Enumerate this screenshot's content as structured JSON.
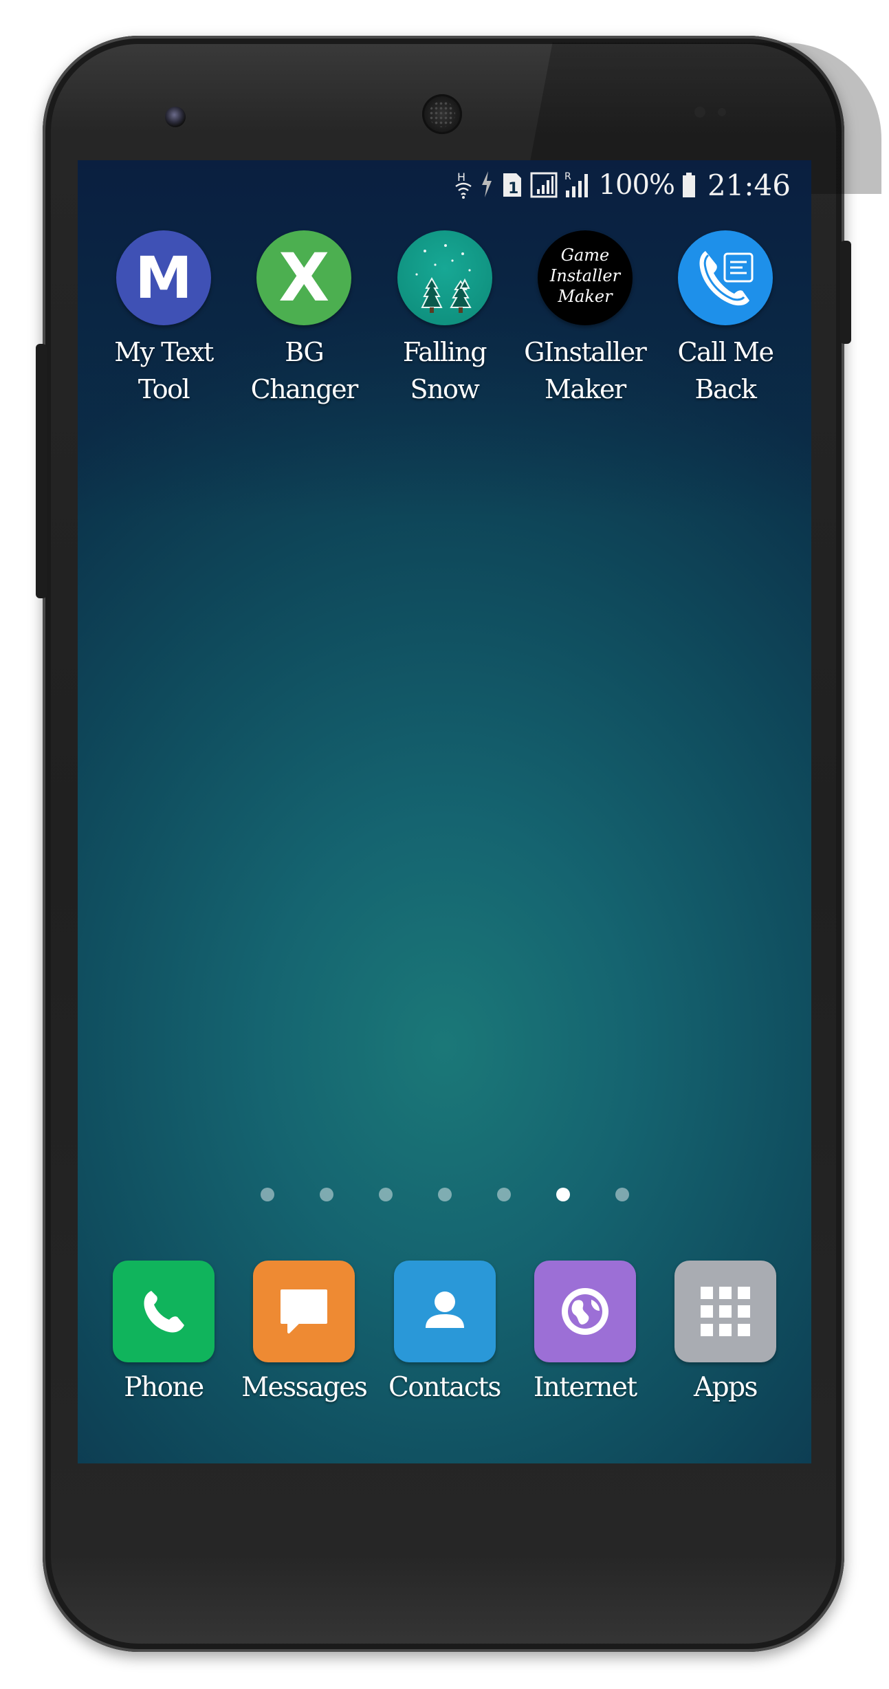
{
  "status_bar": {
    "network_type": "H",
    "sim_slot": "1",
    "roaming": "R",
    "battery_percent": "100%",
    "time": "21:46"
  },
  "home_apps": [
    {
      "label_line1": "My Text",
      "label_line2": "Tool",
      "icon": "letter-m-icon",
      "color": "#3f51b5",
      "glyph": "M"
    },
    {
      "label_line1": "BG",
      "label_line2": "Changer",
      "icon": "letter-x-icon",
      "color": "#4caf50",
      "glyph": "X"
    },
    {
      "label_line1": "Falling",
      "label_line2": "Snow",
      "icon": "snow-trees-icon",
      "color": "#0e9a86"
    },
    {
      "label_line1": "GInstaller",
      "label_line2": "Maker",
      "icon": "game-installer-maker-icon",
      "color": "#000000",
      "logo_text": "Game Installer Maker"
    },
    {
      "label_line1": "Call Me",
      "label_line2": "Back",
      "icon": "phone-callback-icon",
      "color": "#1e88e5"
    }
  ],
  "page_indicator": {
    "total": 7,
    "active_index": 5
  },
  "dock": [
    {
      "label": "Phone",
      "icon": "phone-icon",
      "color": "#10b45c"
    },
    {
      "label": "Messages",
      "icon": "message-bubble-icon",
      "color": "#ee8a33"
    },
    {
      "label": "Contacts",
      "icon": "person-icon",
      "color": "#2a98d8"
    },
    {
      "label": "Internet",
      "icon": "globe-icon",
      "color": "#9c6fd6"
    },
    {
      "label": "Apps",
      "icon": "app-grid-icon",
      "color": "#a9acb2"
    }
  ]
}
